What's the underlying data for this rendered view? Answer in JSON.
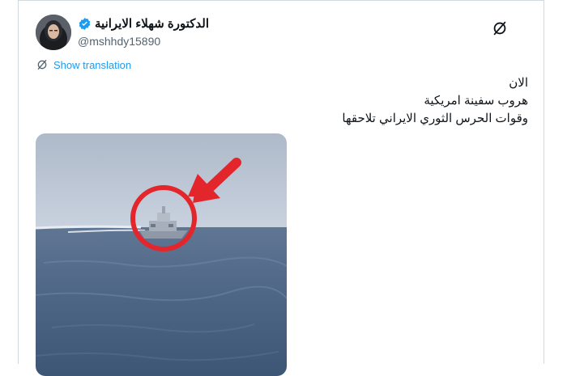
{
  "author": {
    "display_name": "الدكتورة شهلاء الايرانية",
    "handle": "@mshhdy15890",
    "verified": true,
    "avatar_icon": "avatar-woman-hijab"
  },
  "actions": {
    "grok_icon": "grok-icon",
    "translate_icon": "translate-icon",
    "show_translation_label": "Show translation"
  },
  "tweet": {
    "lines": [
      "الان",
      "هروب سفينة امريكية",
      "وقوات الحرس الثوري الايراني تلاحقها"
    ]
  },
  "media": {
    "type": "video-thumbnail",
    "description_icon": "ship-at-sea-image",
    "annotations": [
      "red-circle",
      "red-arrow"
    ]
  },
  "colors": {
    "accent": "#1d9bf0",
    "text": "#0f1419",
    "secondary": "#536471",
    "annotation": "#e3262b"
  }
}
